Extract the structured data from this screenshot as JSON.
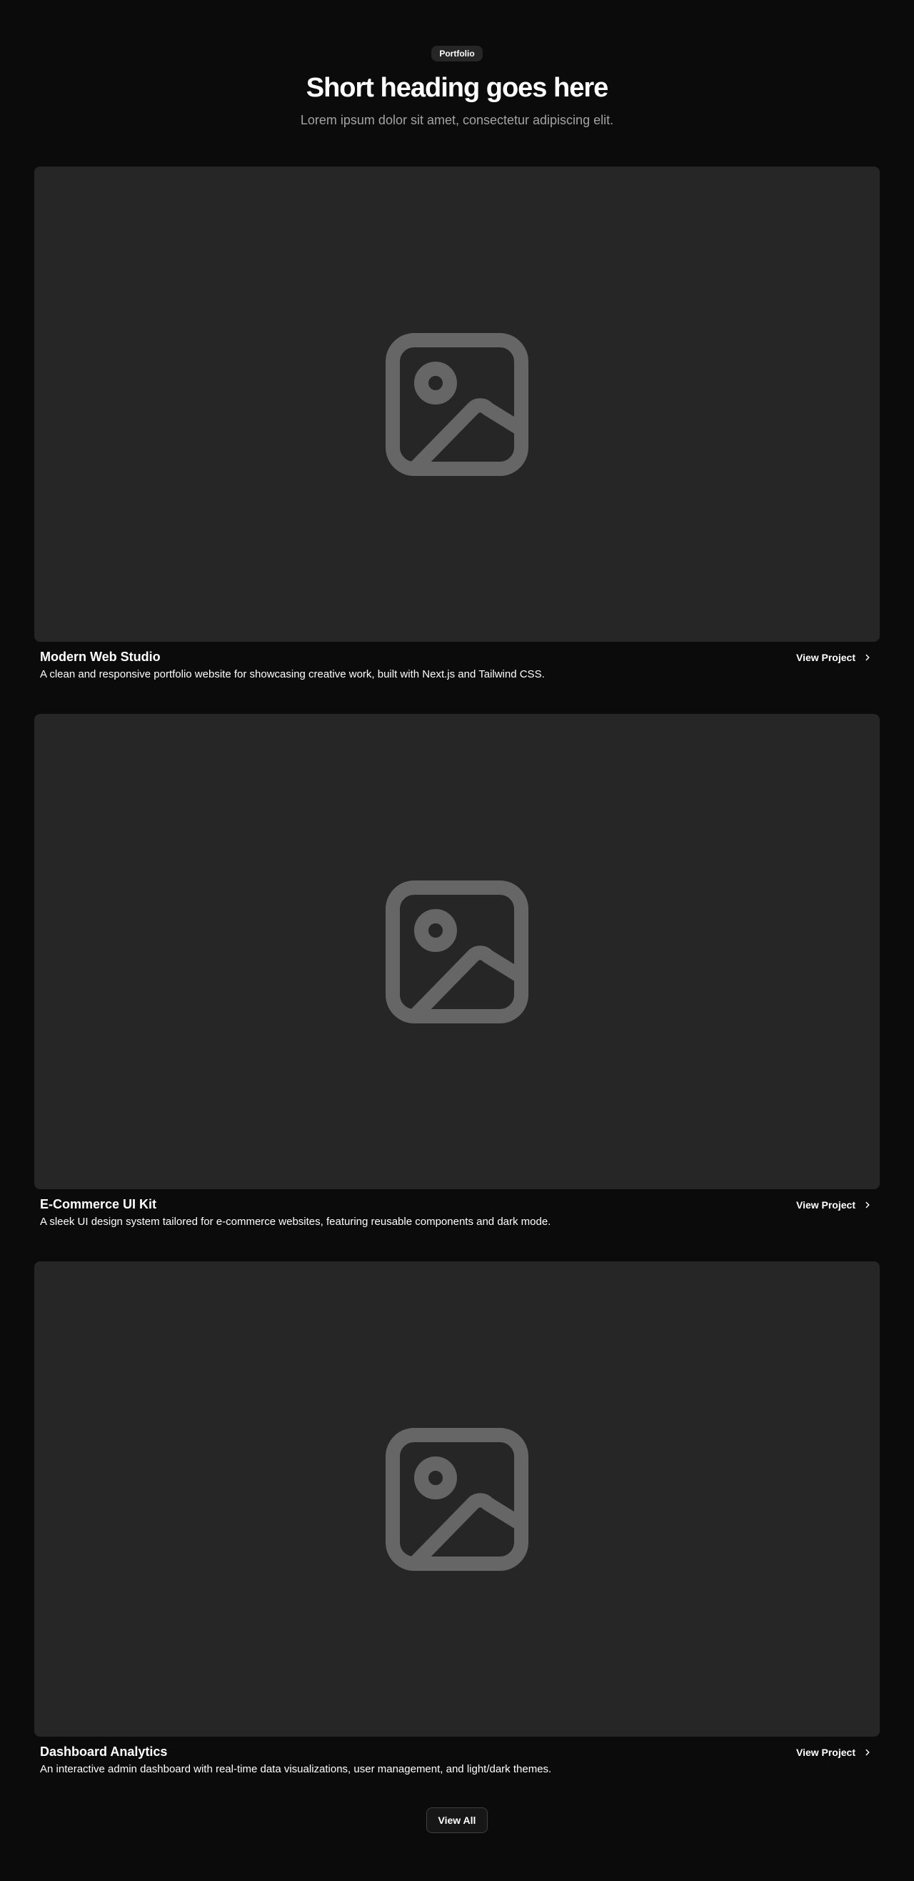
{
  "header": {
    "badge": "Portfolio",
    "title": "Short heading goes here",
    "subtitle": "Lorem ipsum dolor sit amet, consectetur adipiscing elit."
  },
  "projects": [
    {
      "title": "Modern Web Studio",
      "description": "A clean and responsive portfolio website for showcasing creative work, built with Next.js and Tailwind CSS.",
      "link_label": "View Project",
      "image_icon": "image-placeholder-icon"
    },
    {
      "title": "E-Commerce UI Kit",
      "description": "A sleek UI design system tailored for e-commerce websites, featuring reusable components and dark mode.",
      "link_label": "View Project",
      "image_icon": "image-placeholder-icon"
    },
    {
      "title": "Dashboard Analytics",
      "description": "An interactive admin dashboard with real-time data visualizations, user management, and light/dark themes.",
      "link_label": "View Project",
      "image_icon": "image-placeholder-icon"
    }
  ],
  "footer": {
    "view_all_label": "View All"
  },
  "colors": {
    "background": "#0b0b0b",
    "card": "#262626",
    "icon": "#666666",
    "muted_text": "#a3a3a3"
  }
}
